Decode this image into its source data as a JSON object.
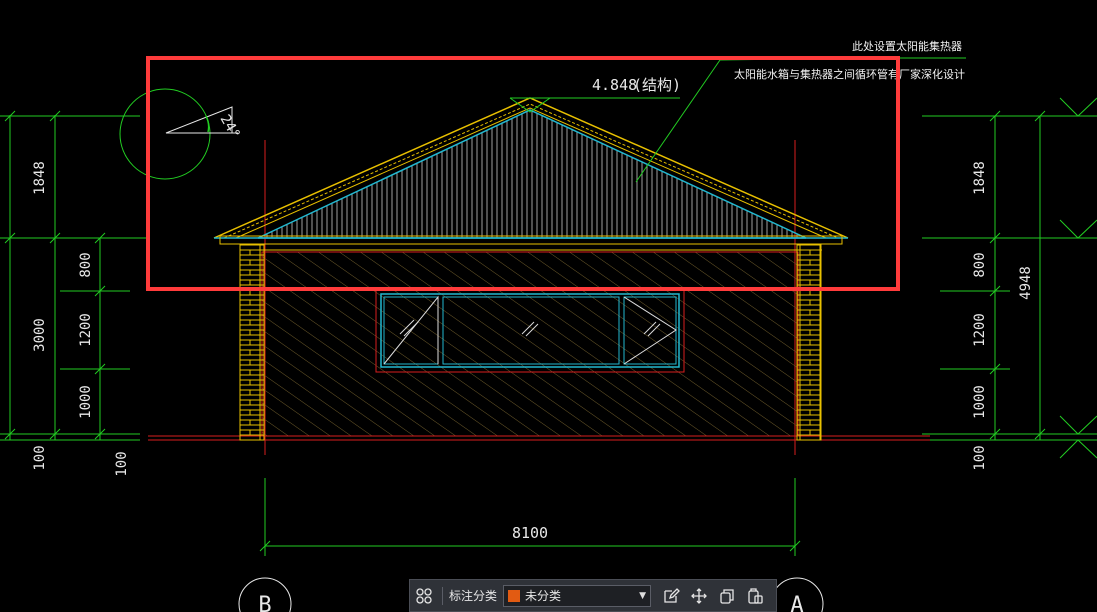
{
  "drawing": {
    "ridge_elevation": "4.848",
    "ridge_note": "(结构)",
    "solar_note_1": "此处设置太阳能集热器",
    "solar_note_2": "太阳能水箱与集热器之间循环管有厂家深化设计",
    "slope_label": "24°",
    "overall_width": "8100",
    "left_dims": [
      "1848",
      "3000",
      "800",
      "1200",
      "1000",
      "100",
      "100"
    ],
    "right_dims": [
      "1848",
      "800",
      "1200",
      "1000",
      "100",
      "4948"
    ],
    "axis_left": "B",
    "axis_right": "A"
  },
  "colors": {
    "selection_box": "#ff3b3b",
    "dimension_green": "#22cc22",
    "roof_yellow": "#e8c000",
    "glass_cyan": "#22b8d0",
    "red_line": "#d81e1e"
  },
  "toolbar": {
    "grid_icon": "grid-icon",
    "category_label": "标注分类",
    "category_value": "未分类",
    "category_color": "#e25b12",
    "icons": [
      "edit-icon",
      "move-icon",
      "copy-icon",
      "paste-icon"
    ]
  }
}
